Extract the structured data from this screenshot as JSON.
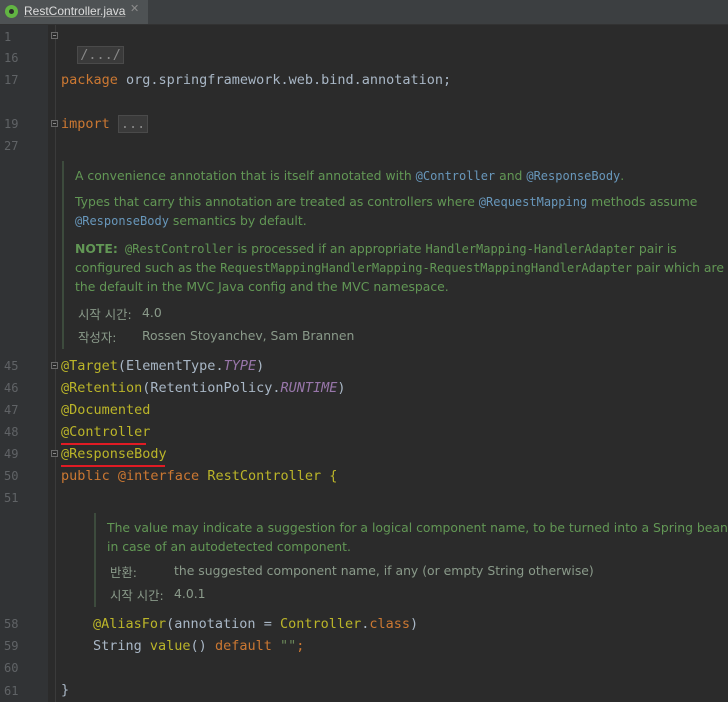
{
  "tab": {
    "filename": "RestController.java",
    "close": "✕"
  },
  "lines": {
    "l1": "1",
    "l16": "16",
    "l17": "17",
    "l19": "19",
    "l27": "27",
    "l45": "45",
    "l46": "46",
    "l47": "47",
    "l48": "48",
    "l49": "49",
    "l50": "50",
    "l51": "51",
    "l58": "58",
    "l59": "59",
    "l60": "60",
    "l61": "61"
  },
  "code": {
    "header_fold": "/.../",
    "package_kw": "package",
    "package_name": " org.springframework.web.bind.annotation;",
    "import_kw": "import",
    "import_fold": "...",
    "target_ann": "@Target",
    "target_open": "(ElementType.",
    "target_val": "TYPE",
    "target_close": ")",
    "retention_ann": "@Retention",
    "retention_open": "(RetentionPolicy.",
    "retention_val": "RUNTIME",
    "retention_close": ")",
    "documented_ann": "@Documented",
    "controller_ann": "@Controller",
    "responsebody_ann": "@ResponseBody",
    "public_kw": "public",
    "interface_kw": " @interface",
    "interface_name": " RestController {",
    "aliasfor_ann": "@AliasFor",
    "aliasfor_open": "(annotation = ",
    "aliasfor_class": "Controller",
    "aliasfor_dot": ".",
    "aliasfor_class_kw": "class",
    "aliasfor_close": ")",
    "string_type": "String ",
    "value_method": "value",
    "value_parens": "() ",
    "default_kw": "default",
    "default_val": " \"\"",
    "semicolon": ";",
    "closing_brace": "}"
  },
  "doc1": {
    "p1_a": "A convenience annotation that is itself annotated with ",
    "p1_ref1": "@Controller",
    "p1_b": " and ",
    "p1_ref2": "@ResponseBody",
    "p1_c": ".",
    "p2_a": "Types that carry this annotation are treated as controllers where ",
    "p2_ref1": "@RequestMapping",
    "p2_b": " methods assume",
    "p2_ref2": "@ResponseBody",
    "p2_c": " semantics by default.",
    "p3_note": "NOTE:",
    "p3_mono1": " @RestController",
    "p3_a": " is processed if an appropriate ",
    "p3_mono2": "HandlerMapping-HandlerAdapter",
    "p3_b": " pair is",
    "p3_c": "configured such as the ",
    "p3_mono3": "RequestMappingHandlerMapping-RequestMappingHandlerAdapter",
    "p3_d": " pair which are",
    "p3_e": "the default in the MVC Java config and the MVC namespace.",
    "since_label": "시작 시간:",
    "since_value": "4.0",
    "author_label": "작성자:",
    "author_value": "Rossen Stoyanchev, Sam Brannen"
  },
  "doc2": {
    "p1_a": "The value may indicate a suggestion for a logical component name, to be turned into a Spring bean",
    "p1_b": "in case of an autodetected component.",
    "returns_label": "반환:",
    "returns_value": "the suggested component name, if any (or empty String otherwise)",
    "since_label": "시작 시간:",
    "since_value": "4.0.1"
  },
  "colors": {
    "background": "#2b2b2b",
    "keyword": "#cc7832",
    "annotation": "#bbb529",
    "doc_comment": "#629755",
    "underline": "#e01b24"
  }
}
